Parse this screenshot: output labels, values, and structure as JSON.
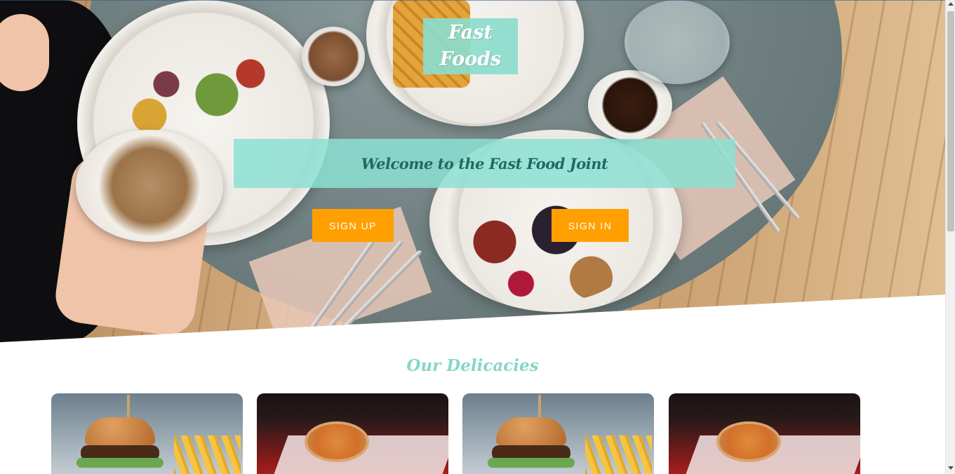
{
  "hero": {
    "logo_line1": "Fast",
    "logo_line2": "Foods",
    "welcome_text": "Welcome to the Fast Food Joint",
    "signup_label": "SIGN UP",
    "signin_label": "SIGN IN",
    "accent_color": "#ffa000",
    "teal_color": "#8ce1d2"
  },
  "section": {
    "title": "Our Delicacies"
  },
  "cards": [
    {
      "image": "burger-and-fries-photo"
    },
    {
      "image": "pizza-table-photo"
    },
    {
      "image": "burger-and-fries-photo"
    },
    {
      "image": "pizza-table-photo"
    }
  ]
}
